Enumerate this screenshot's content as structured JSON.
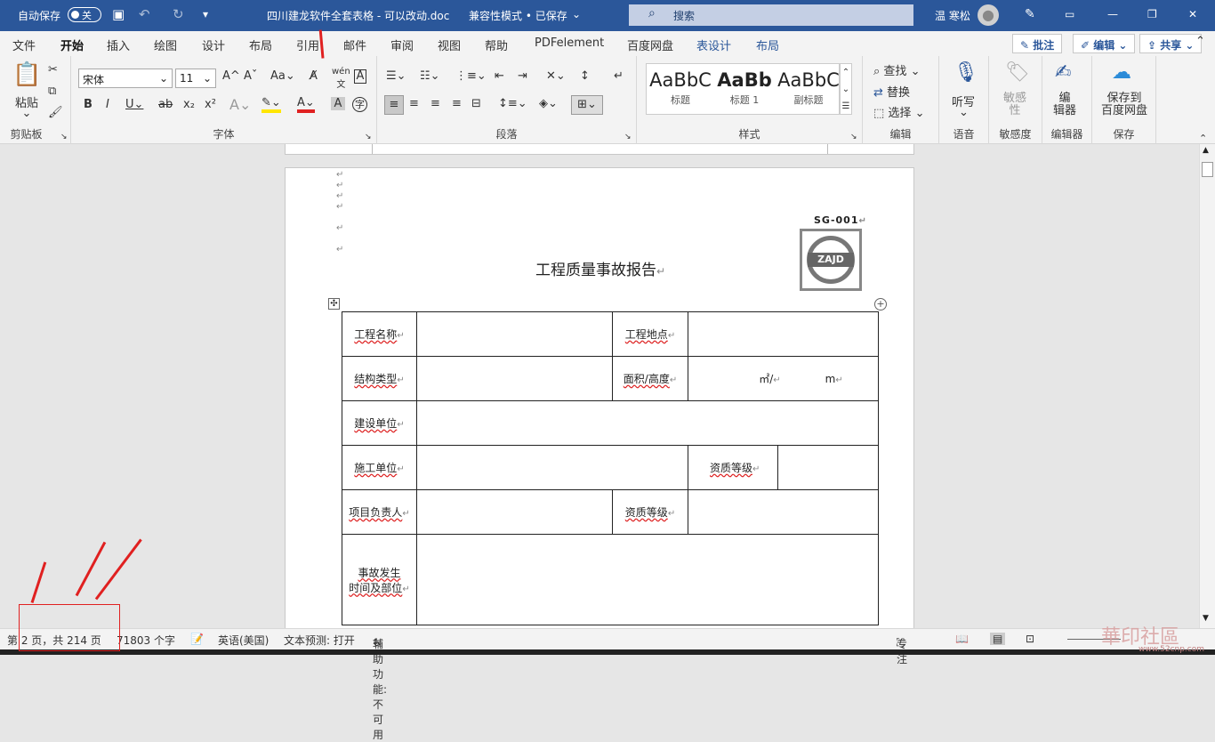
{
  "titlebar": {
    "autosave_label": "自动保存",
    "autosave_state": "关",
    "doc_title": "四川建龙软件全套表格 - 可以改动.doc",
    "compat_mode": "兼容性模式 • 已保存",
    "search_placeholder": "搜索",
    "user_name": "温 寒松"
  },
  "tabs": [
    "文件",
    "开始",
    "插入",
    "绘图",
    "设计",
    "布局",
    "引用",
    "邮件",
    "审阅",
    "视图",
    "帮助",
    "PDFelement",
    "百度网盘",
    "表设计",
    "布局"
  ],
  "tab_buttons": {
    "comment": "批注",
    "edit": "编辑",
    "share": "共享"
  },
  "ribbon": {
    "clipboard": {
      "paste": "粘贴",
      "label": "剪贴板"
    },
    "font": {
      "name": "宋体",
      "size": "11",
      "label": "字体"
    },
    "paragraph": {
      "label": "段落"
    },
    "styles": {
      "items": [
        {
          "preview": "AaBbC",
          "name": "标题"
        },
        {
          "preview": "AaBb",
          "name": "标题 1"
        },
        {
          "preview": "AaBbC",
          "name": "副标题"
        }
      ],
      "label": "样式"
    },
    "editing": {
      "find": "查找",
      "replace": "替换",
      "select": "选择",
      "label": "编辑"
    },
    "voice": {
      "dictate": "听写",
      "label": "语音"
    },
    "sensitivity": {
      "btn": "敏感\n性",
      "label": "敏感度"
    },
    "editor": {
      "btn": "编\n辑器",
      "label": "编辑器"
    },
    "save": {
      "btn": "保存到\n百度网盘",
      "label": "保存"
    }
  },
  "document": {
    "form_code": "SG-001",
    "logo_text": "ZAJD",
    "title": "工程质量事故报告",
    "rows": [
      {
        "a": "工程名称",
        "c": "工程地点"
      },
      {
        "a": "结构类型",
        "c": "面积/高度",
        "d1": "㎡/",
        "d2": "m"
      },
      {
        "a": "建设单位"
      },
      {
        "a": "施工单位",
        "c": "资质等级"
      },
      {
        "a": "项目负责人",
        "c": "资质等级"
      },
      {
        "a1": "事故发生",
        "a2": "时间及部位"
      }
    ]
  },
  "statusbar": {
    "page": "第 2 页，共 214 页",
    "words": "71803 个字",
    "language": "英语(美国)",
    "text_predict": "文本预测: 打开",
    "accessibility": "辅助功能: 不可用",
    "focus": "专注"
  },
  "watermark": "華印社區",
  "watermark_url": "www.52cnp.com",
  "colors": {
    "titlebar": "#2b579a",
    "annotation": "#e02020"
  }
}
